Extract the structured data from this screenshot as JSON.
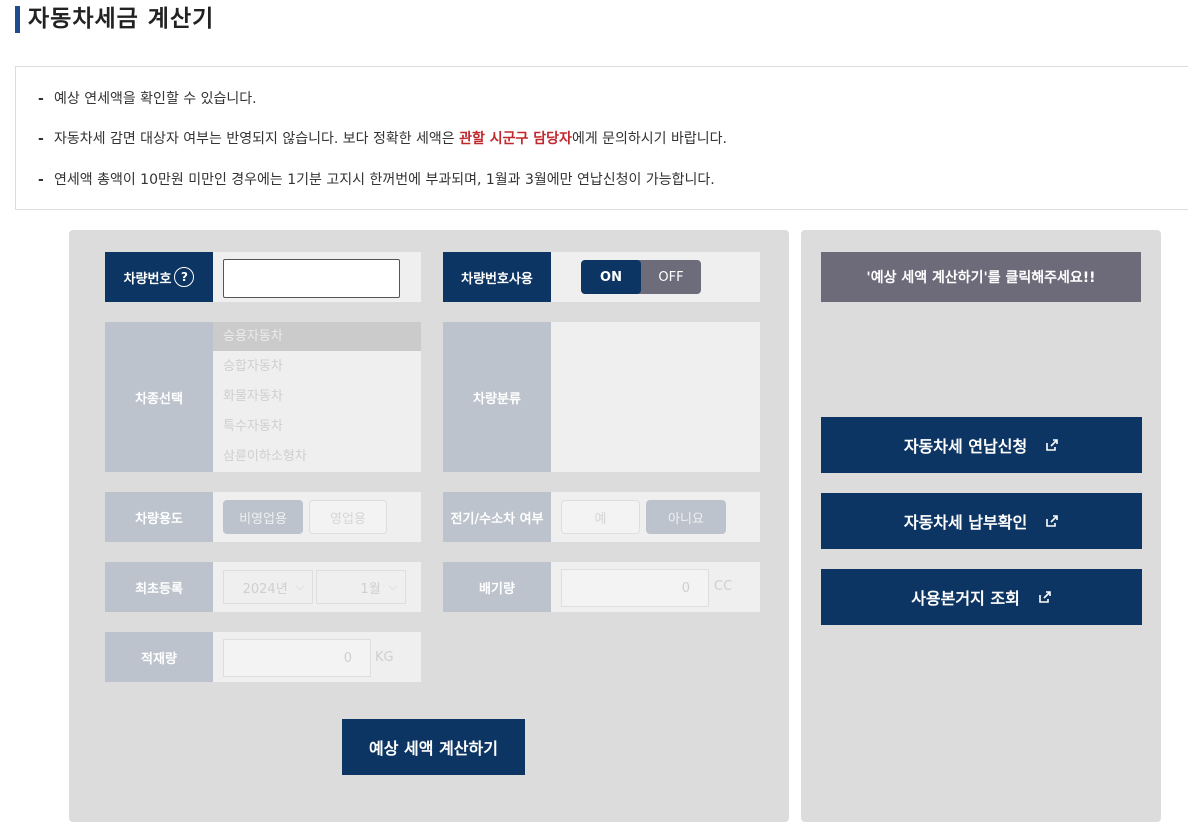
{
  "page": {
    "title": "자동차세금 계산기"
  },
  "info": {
    "line1": "예상 연세액을 확인할 수 있습니다.",
    "line2_pre": "자동차세 감면 대상자 여부는 반영되지 않습니다. 보다 정확한 세액은 ",
    "line2_highlight": "관할 시군구 담당자",
    "line2_post": "에게 문의하시기 바랍니다.",
    "line3": "연세액 총액이 10만원 미만인 경우에는 1기분 고지시 한꺼번에 부과되며, 1월과 3월에만 연납신청이 가능합니다."
  },
  "form": {
    "plate_label": "차량번호",
    "plate_value": "",
    "use_plate_label": "차량번호사용",
    "toggle": {
      "on": "ON",
      "off": "OFF",
      "selected": "ON"
    },
    "car_type_label": "차종선택",
    "car_types": [
      "승용자동차",
      "승합자동차",
      "화물자동차",
      "특수자동차",
      "삼륜이하소형차"
    ],
    "car_class_label": "차량분류",
    "usage_label": "차량용도",
    "usage_options": [
      "비영업용",
      "영업용"
    ],
    "ev_label": "전기/수소차 여부",
    "ev_options": [
      "예",
      "아니요"
    ],
    "reg_label": "최초등록",
    "reg_year": "2024년",
    "reg_month": "1월",
    "displacement_label": "배기량",
    "displacement_value": "0",
    "displacement_unit": "CC",
    "load_label": "적재량",
    "load_value": "0",
    "load_unit": "KG",
    "calc_button": "예상 세액 계산하기"
  },
  "result": {
    "message": "'예상 세액 계산하기'를 클릭해주세요!!",
    "links": [
      "자동차세 연납신청",
      "자동차세 납부확인",
      "사용본거지 조회"
    ]
  },
  "colors": {
    "primary": "#0c3563",
    "accent": "#1e4c8f",
    "highlight": "#c0282d",
    "message_bg": "#6d6a7a"
  }
}
